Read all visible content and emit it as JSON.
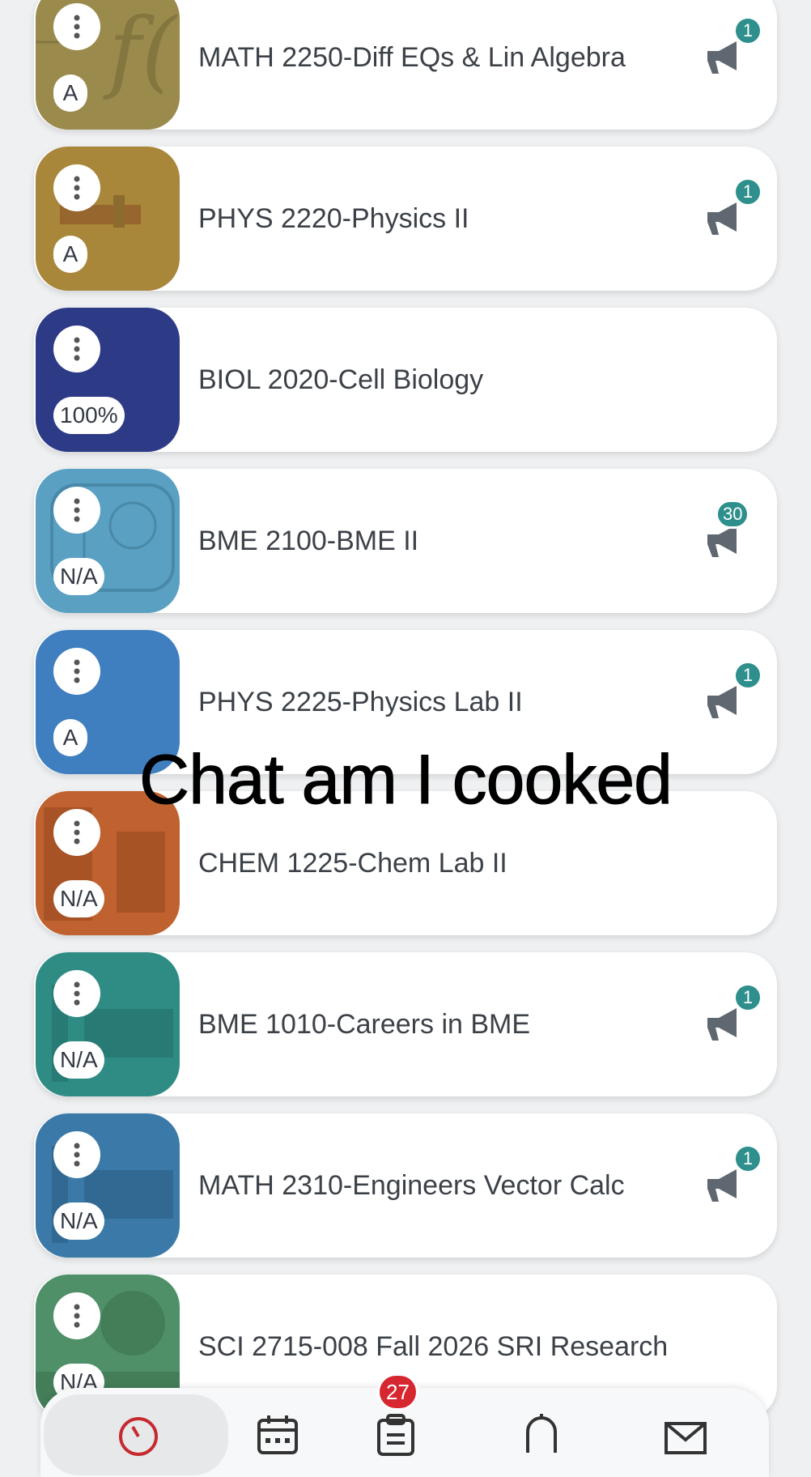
{
  "colors": {
    "background": "#eef0f2",
    "card": "#ffffff",
    "badge_teal": "#2e8f8c",
    "badge_red": "#d6262f",
    "icon_gray": "#5f6770"
  },
  "courses": [
    {
      "title": "MATH 2250-Diff EQs & Lin Algebra",
      "grade": "A",
      "tile_color": "#9a8b4c",
      "announcements": "1",
      "menu_icon": "kebab-menu-icon",
      "announce_icon": "megaphone-icon"
    },
    {
      "title": "PHYS 2220-Physics II",
      "grade": "A",
      "tile_color": "#a8863a",
      "announcements": "1",
      "menu_icon": "kebab-menu-icon",
      "announce_icon": "megaphone-icon"
    },
    {
      "title": "BIOL 2020-Cell Biology",
      "grade": "100%",
      "tile_color": "#2d3a86",
      "announcements": "",
      "menu_icon": "kebab-menu-icon",
      "announce_icon": ""
    },
    {
      "title": "BME 2100-BME II",
      "grade": "N/A",
      "tile_color": "#5aa0c2",
      "announcements": "30",
      "menu_icon": "kebab-menu-icon",
      "announce_icon": "megaphone-icon"
    },
    {
      "title": "PHYS 2225-Physics Lab II",
      "grade": "A",
      "tile_color": "#3f7fbf",
      "announcements": "1",
      "menu_icon": "kebab-menu-icon",
      "announce_icon": "megaphone-icon"
    },
    {
      "title": "CHEM 1225-Chem Lab II",
      "grade": "N/A",
      "tile_color": "#c0622f",
      "announcements": "",
      "menu_icon": "kebab-menu-icon",
      "announce_icon": ""
    },
    {
      "title": "BME 1010-Careers in BME",
      "grade": "N/A",
      "tile_color": "#2f8c85",
      "announcements": "1",
      "menu_icon": "kebab-menu-icon",
      "announce_icon": "megaphone-icon"
    },
    {
      "title": "MATH 2310-Engineers Vector Calc",
      "grade": "N/A",
      "tile_color": "#3b7aa8",
      "announcements": "1",
      "menu_icon": "kebab-menu-icon",
      "announce_icon": "megaphone-icon"
    },
    {
      "title": "SCI 2715-008 Fall 2026 SRI Research",
      "grade": "N/A",
      "tile_color": "#4f9068",
      "announcements": "",
      "menu_icon": "kebab-menu-icon",
      "announce_icon": ""
    }
  ],
  "overlay": {
    "caption": "Chat am I cooked"
  },
  "bottom_nav": {
    "items": [
      {
        "icon": "dashboard-gauge-icon"
      },
      {
        "icon": "calendar-icon"
      },
      {
        "icon": "todo-clipboard-icon",
        "badge": "27"
      },
      {
        "icon": "notifications-bell-icon"
      },
      {
        "icon": "inbox-mail-icon"
      }
    ]
  }
}
